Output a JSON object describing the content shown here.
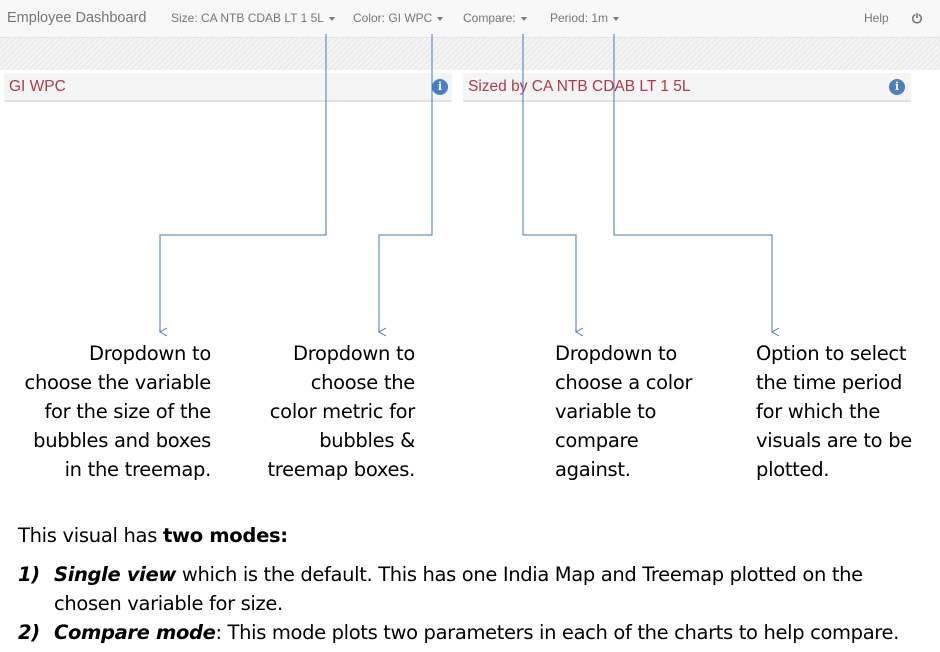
{
  "navbar": {
    "brand": "Employee Dashboard",
    "size_dropdown": "Size: CA NTB CDAB LT 1 5L",
    "color_dropdown": "Color: GI WPC",
    "compare_dropdown": "Compare:",
    "period_dropdown": "Period: 1m",
    "help": "Help",
    "power_icon": "power-icon"
  },
  "panels": [
    {
      "title": "GI WPC",
      "icon": "info-icon"
    },
    {
      "title": "Sized by CA NTB CDAB LT 1 5L",
      "icon": "info-icon"
    }
  ],
  "callouts": {
    "size": [
      "Dropdown to",
      "choose the variable",
      "for the size of the",
      "bubbles and boxes",
      "in the treemap."
    ],
    "color": [
      "Dropdown to",
      "choose the",
      "color metric for",
      "bubbles &",
      "treemap boxes."
    ],
    "compare": [
      "Dropdown to",
      "choose a color",
      "variable to",
      "compare",
      "against."
    ],
    "period": [
      "Option to select",
      "the time period",
      "for which the",
      "visuals are to be",
      "plotted."
    ]
  },
  "description": {
    "intro_prefix": "This visual has ",
    "intro_bold": "two modes:",
    "modes": [
      {
        "number": "1)",
        "name": "Single view",
        "text_line1": " which is the default. This has one India Map and Treemap plotted on the",
        "text_line2": "chosen variable for size."
      },
      {
        "number": "2)",
        "name": "Compare mode",
        "text_line1": ": This mode plots two parameters in each of the charts to help compare."
      }
    ]
  },
  "colors": {
    "panel_title": "#b03a48",
    "info_icon": "#4a7fc1",
    "callout_line": "#4a7ab5",
    "nav_text": "#777777"
  }
}
